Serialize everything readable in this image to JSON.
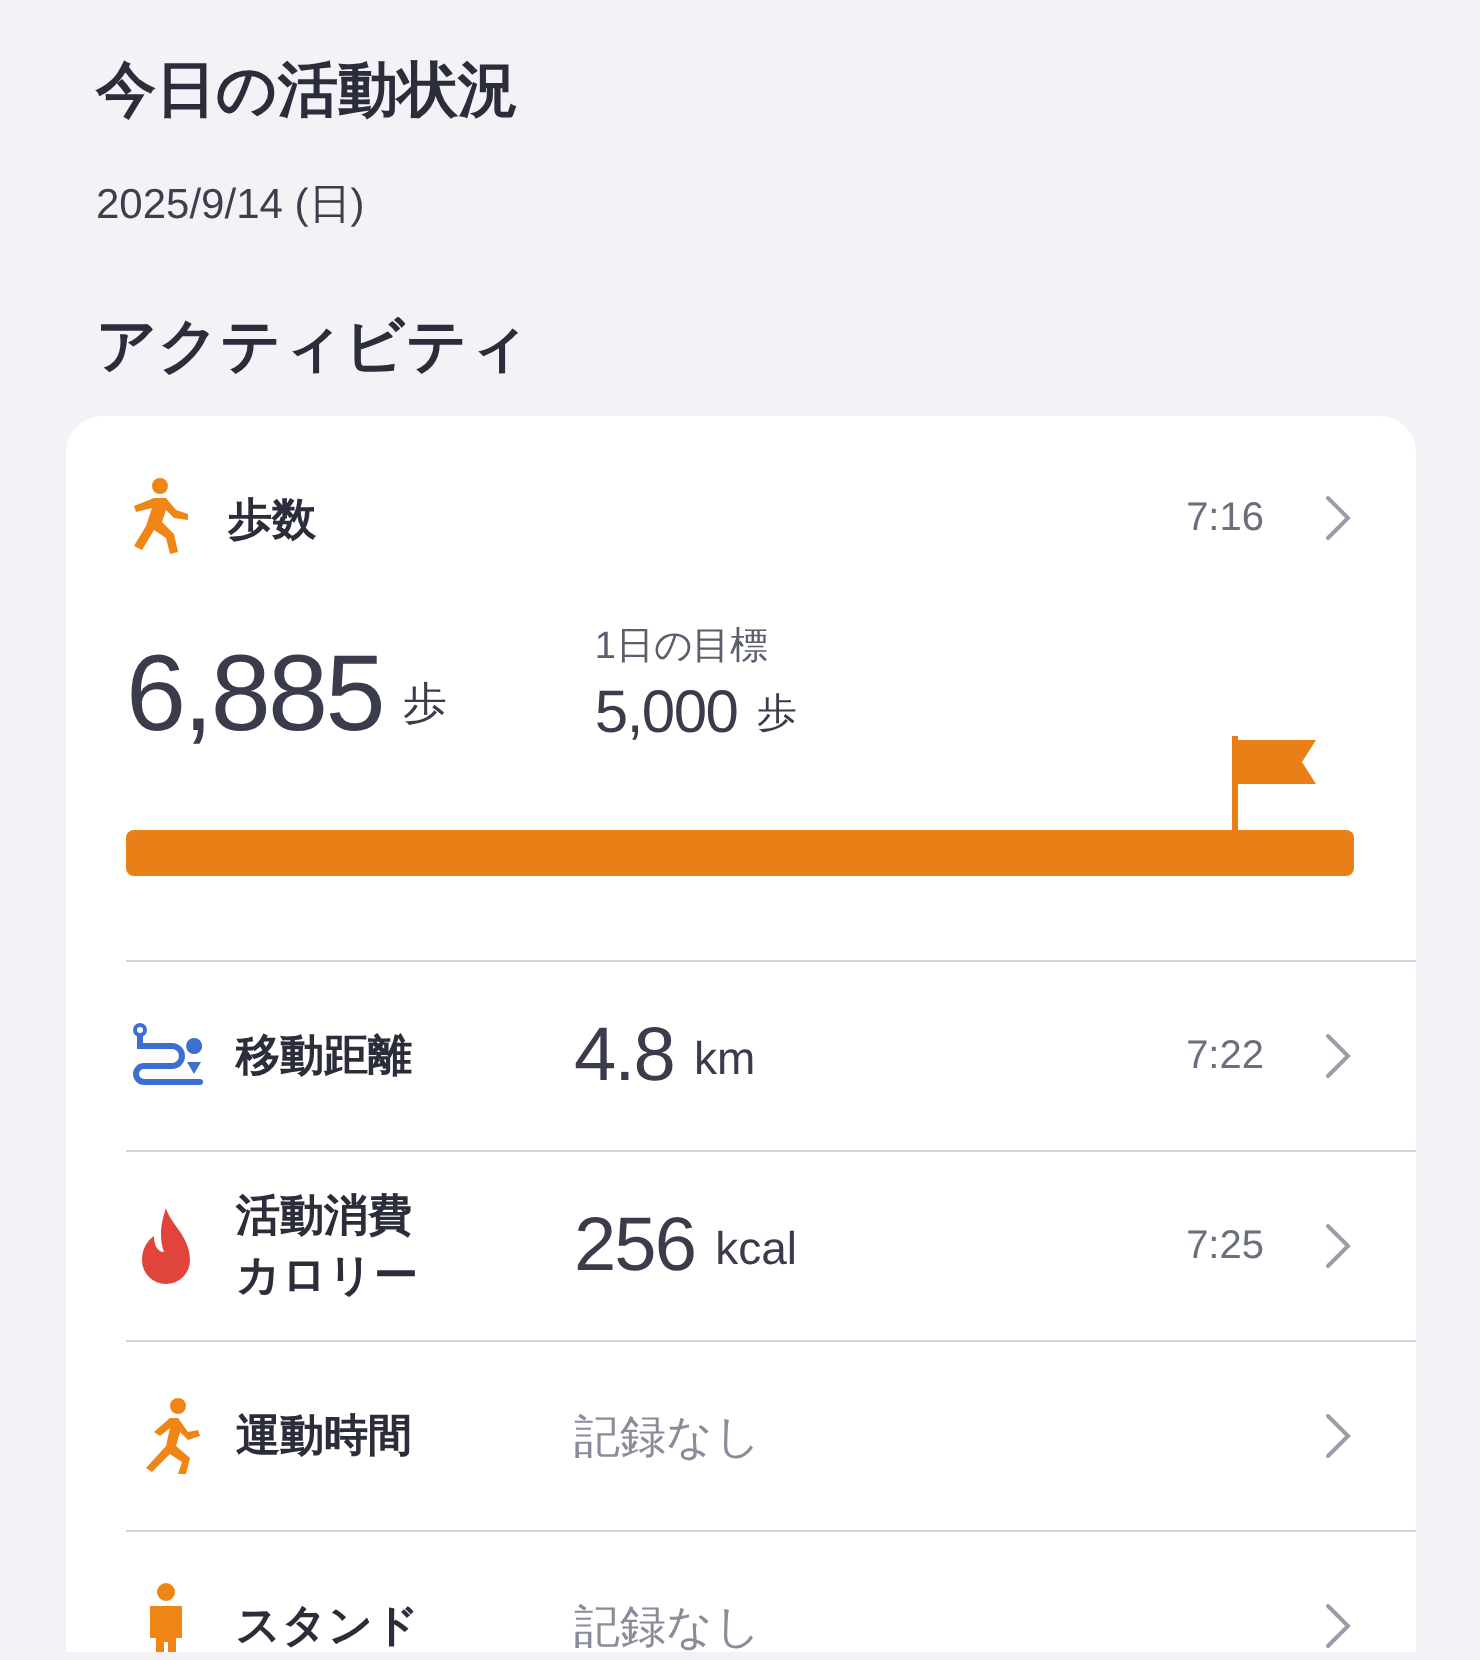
{
  "title": "今日の活動状況",
  "date": "2025/9/14 (日)",
  "section_title": "アクティビティ",
  "steps": {
    "label": "歩数",
    "time": "7:16",
    "value": "6,885",
    "unit": "歩",
    "goal_label": "1日の目標",
    "goal_value": "5,000",
    "goal_unit": "歩",
    "level": 1
  },
  "metrics": [
    {
      "kind": "value",
      "label": "移動距離",
      "value": "4.8",
      "unit": "km",
      "time": "7:22"
    },
    {
      "kind": "value",
      "label": "活動消費カロリー",
      "value": "256",
      "unit": "kcal",
      "time": "7:25"
    },
    {
      "kind": "none",
      "label": "運動時間",
      "value": "記録なし"
    },
    {
      "kind": "none",
      "label": "スタンド",
      "value": "記録なし"
    }
  ]
}
